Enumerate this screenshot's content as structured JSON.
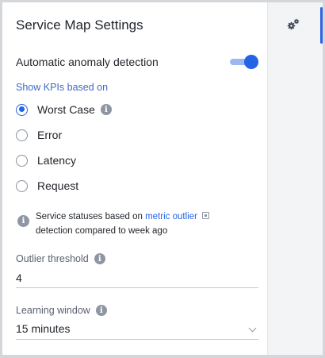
{
  "panel": {
    "title": "Service Map Settings",
    "anomaly_detection": {
      "label": "Automatic anomaly detection",
      "enabled": true
    },
    "kpi_section": {
      "label": "Show KPIs based on",
      "options": [
        {
          "label": "Worst Case",
          "checked": true,
          "has_info": true
        },
        {
          "label": "Error",
          "checked": false
        },
        {
          "label": "Latency",
          "checked": false
        },
        {
          "label": "Request",
          "checked": false
        }
      ]
    },
    "status_note": {
      "prefix": "Service statuses based on ",
      "link": "metric outlier",
      "suffix": "detection compared to week ago"
    },
    "outlier_threshold": {
      "label": "Outlier threshold",
      "value": "4"
    },
    "learning_window": {
      "label": "Learning window",
      "value": "15 minutes"
    }
  },
  "rail": {
    "settings_icon": "gears-icon"
  },
  "colors": {
    "accent": "#2462e6",
    "section_label": "#3d6ac7",
    "info_icon": "#8f96a3",
    "rail_bg": "#f3f4f6"
  }
}
